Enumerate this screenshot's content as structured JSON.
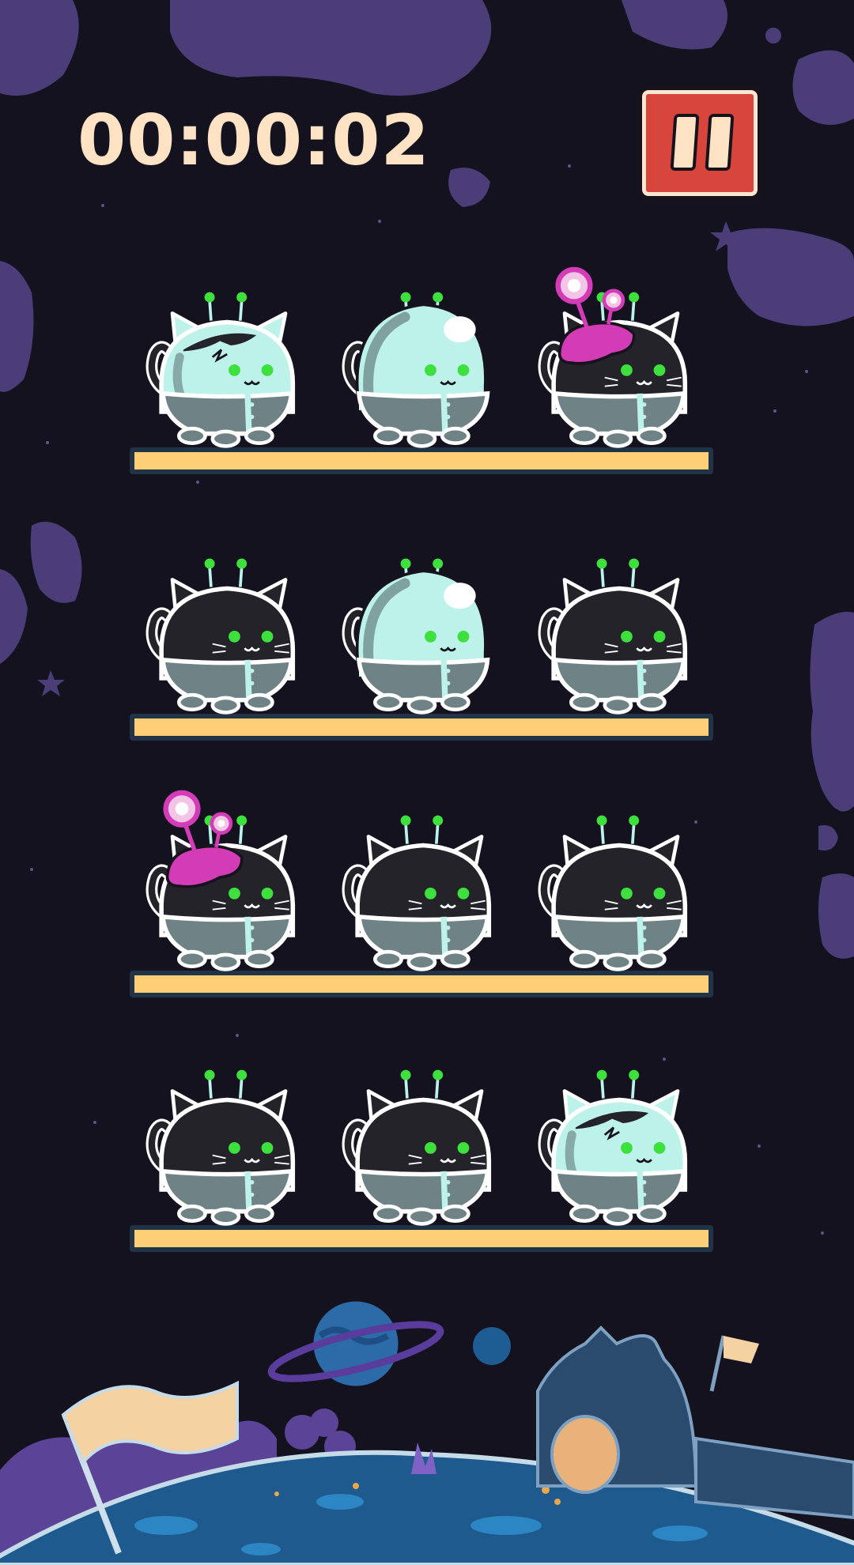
{
  "hud": {
    "timer": "00:00:02",
    "pause_button_icon": "pause-icon"
  },
  "colors": {
    "background": "#15121f",
    "rock": "#4a3d78",
    "shelf": "#ffcf75",
    "shelf_outline": "#213346",
    "cat_dark": "#24232a",
    "suit_glass": "#bdf2ea",
    "suit_grey": "#6f8386",
    "eyes": "#3de03c",
    "slime": "#d43bb6",
    "pause_button": "#d8453d",
    "timer_text": "#fde3c4",
    "planet": "#1d5d92"
  },
  "shelves": [
    {
      "cats": [
        {
          "variant": "cracked-helmet"
        },
        {
          "variant": "full-helmet"
        },
        {
          "variant": "slime-alien"
        }
      ]
    },
    {
      "cats": [
        {
          "variant": "normal"
        },
        {
          "variant": "full-helmet"
        },
        {
          "variant": "normal"
        }
      ]
    },
    {
      "cats": [
        {
          "variant": "slime-alien"
        },
        {
          "variant": "normal"
        },
        {
          "variant": "normal"
        }
      ]
    },
    {
      "cats": [
        {
          "variant": "normal"
        },
        {
          "variant": "normal"
        },
        {
          "variant": "cracked-helmet"
        }
      ]
    }
  ]
}
